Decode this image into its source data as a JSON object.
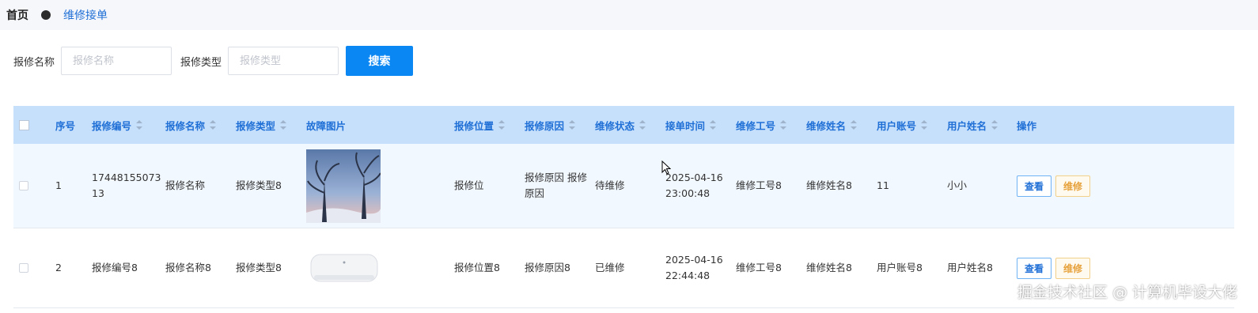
{
  "breadcrumb": {
    "home": "首页",
    "current": "维修接单"
  },
  "search": {
    "name_label": "报修名称",
    "name_placeholder": "报修名称",
    "type_label": "报修类型",
    "type_placeholder": "报修类型",
    "button_label": "搜索"
  },
  "table": {
    "headers": {
      "index": "序号",
      "code": "报修编号",
      "name": "报修名称",
      "type": "报修类型",
      "image": "故障图片",
      "location": "报修位置",
      "reason": "报修原因",
      "status": "维修状态",
      "accept_time": "接单时间",
      "worker_no": "维修工号",
      "worker_name": "维修姓名",
      "user_account": "用户账号",
      "user_name": "用户姓名",
      "actions": "操作"
    },
    "rows": [
      {
        "index": "1",
        "code": "1744815507313",
        "name": "报修名称",
        "type": "报修类型8",
        "image": "tree-sunset-photo",
        "location": "报修位",
        "reason": "报修原因 报修原因",
        "status": "待维修",
        "accept_time": "2025-04-16 23:00:48",
        "worker_no": "维修工号8",
        "worker_name": "维修姓名8",
        "user_account": "11",
        "user_name": "小小",
        "view_label": "查看",
        "repair_label": "维修"
      },
      {
        "index": "2",
        "code": "报修编号8",
        "name": "报修名称8",
        "type": "报修类型8",
        "image": "water-heater-photo",
        "location": "报修位置8",
        "reason": "报修原因8",
        "status": "已维修",
        "accept_time": "2025-04-16 22:44:48",
        "worker_no": "维修工号8",
        "worker_name": "维修姓名8",
        "user_account": "用户账号8",
        "user_name": "用户姓名8",
        "view_label": "查看",
        "repair_label": "维修"
      }
    ]
  },
  "watermark": "掘金技术社区 @ 计算机毕设大佬",
  "colors": {
    "accent": "#0b87f3",
    "header_bg": "#c6e0fb",
    "header_text": "#1f6fd6",
    "warning": "#e6a23c"
  }
}
